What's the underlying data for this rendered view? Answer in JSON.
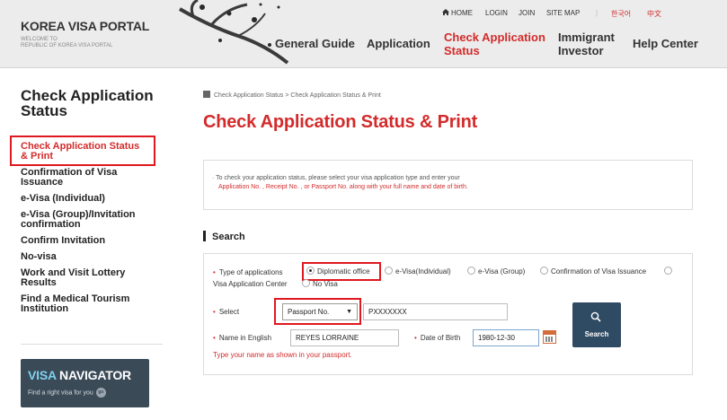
{
  "header": {
    "logo_title": "KOREA VISA PORTAL",
    "logo_sub_1": "WELCOME TO",
    "logo_sub_2": "REPUBLIC OF KOREA VISA PORTAL",
    "top_links": {
      "home": "HOME",
      "login": "LOGIN",
      "join": "JOIN",
      "site_map": "SITE MAP",
      "separator": "|",
      "korean": "한국어",
      "chinese": "中文"
    },
    "nav": {
      "general_guide": "General Guide",
      "application": "Application",
      "check_status_1": "Check Application",
      "check_status_2": "Status",
      "immigrant_1": "Immigrant",
      "immigrant_2": "Investor",
      "help_center": "Help Center"
    }
  },
  "sidebar": {
    "title_1": "Check Application",
    "title_2": "Status",
    "items": [
      {
        "label_1": "Check Application Status",
        "label_2": "& Print"
      },
      {
        "label_1": "Confirmation of Visa",
        "label_2": "Issuance"
      },
      {
        "label_1": "e-Visa (Individual)",
        "label_2": ""
      },
      {
        "label_1": "e-Visa (Group)/Invitation",
        "label_2": "confirmation"
      },
      {
        "label_1": "Confirm Invitation",
        "label_2": ""
      },
      {
        "label_1": "No-visa",
        "label_2": ""
      },
      {
        "label_1": "Work and Visit Lottery",
        "label_2": "Results"
      },
      {
        "label_1": "Find a Medical Tourism",
        "label_2": "Institution"
      }
    ],
    "visa_navigator": {
      "title_a": "VISA",
      "title_b": " NAVIGATOR",
      "subtitle": "Find a right visa for you",
      "go": "go"
    }
  },
  "main": {
    "breadcrumb": "Check Application Status  >  Check Application Status & Print",
    "page_title": "Check Application Status & Print",
    "info_line_1": "· To check your application status, please select your visa application type and enter your",
    "info_line_2": "Application No. , Receipt No. , or Passport No. along with your full name and date of birth.",
    "search_heading": "Search",
    "form": {
      "required_mark": "•",
      "type_label": "Type of applications",
      "options": {
        "diplomatic": "Diplomatic office",
        "evisa_individual": "e-Visa(Individual)",
        "evisa_group": "e-Visa (Group)",
        "confirmation": "Confirmation of Visa Issuance",
        "vac": "Visa Application Center",
        "no_visa": "No Visa"
      },
      "selected_option": "Diplomatic office",
      "select_label": "Select",
      "select_value": "Passport No.",
      "select_arrow": "▼",
      "passport_value": "PXXXXXXX",
      "name_label": "Name in English",
      "name_value": "REYES LORRAINE",
      "dob_label": "Date of Birth",
      "dob_value": "1980-12-30",
      "hint": "Type your name as shown in your passport.",
      "search_button": "Search"
    }
  },
  "colors": {
    "accent_red": "#d32b2b",
    "highlight_box": "#e0181f",
    "button_navy": "#2f4a63",
    "navigator_bg": "#3a4a57"
  }
}
